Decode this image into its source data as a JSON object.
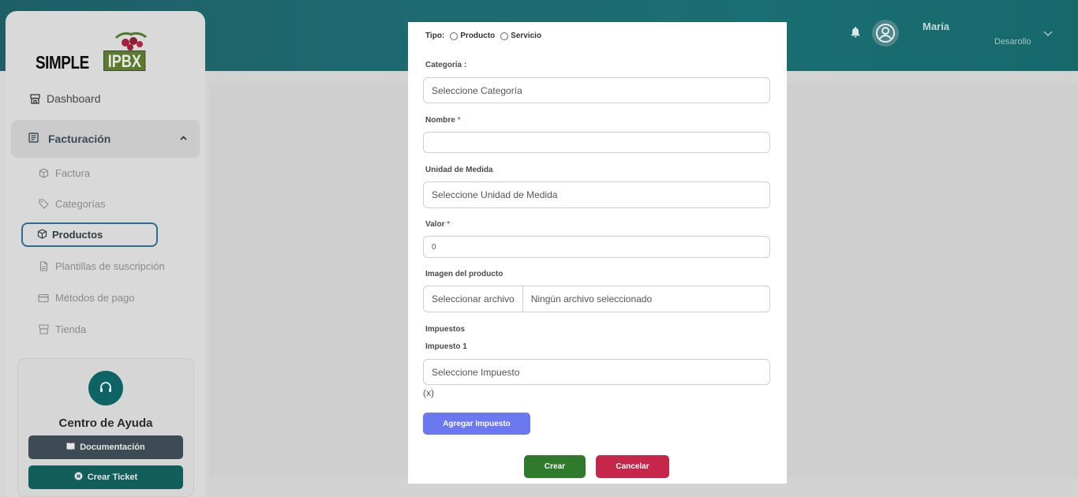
{
  "header": {
    "user_name": "María",
    "user_role": "Desarollo"
  },
  "logo": {
    "word1": "SIMPLE",
    "word2": "IPBX"
  },
  "sidebar": {
    "dashboard": "Dashboard",
    "group": "Facturación",
    "items": [
      {
        "label": "Factura",
        "icon": "box-icon"
      },
      {
        "label": "Categorías",
        "icon": "tag-icon"
      },
      {
        "label": "Productos",
        "icon": "box-icon",
        "active": true
      },
      {
        "label": "Plantillas de suscripción",
        "icon": "document-icon"
      },
      {
        "label": "Métodos de pago",
        "icon": "credit-card-icon"
      },
      {
        "label": "Tienda",
        "icon": "store-icon"
      }
    ],
    "help": {
      "title": "Centro de Ayuda",
      "doc_button": "Documentación",
      "ticket_button": "Crear Ticket"
    }
  },
  "modal": {
    "tipo_label": "Tipo:",
    "tipo_options": [
      "Producto",
      "Servicio"
    ],
    "categoria_label": "Categoría :",
    "categoria_placeholder": "Seleccione Categoría",
    "nombre_label": "Nombre",
    "nombre_value": "",
    "unidad_label": "Unidad de Medida",
    "unidad_placeholder": "Seleccione Unidad de Medida",
    "valor_label": "Valor",
    "valor_value": "0",
    "imagen_label": "Imagen del producto",
    "file_button": "Seleccionar archivo",
    "file_status": "Ningún archivo seleccionado",
    "impuestos_label": "Impuestos",
    "impuesto1_label": "Impuesto 1",
    "impuesto_placeholder": "Seleccione Impuesto",
    "remove_text": "(x)",
    "add_tax_button": "Agregar Impuesto",
    "create_button": "Crear",
    "cancel_button": "Cancelar",
    "required_mark": "*"
  },
  "colors": {
    "header": "#1d6a70",
    "active_border": "#2c6d92",
    "add_button": "#6b78ef",
    "create_button": "#2f7a2d",
    "cancel_button": "#c6264a"
  }
}
